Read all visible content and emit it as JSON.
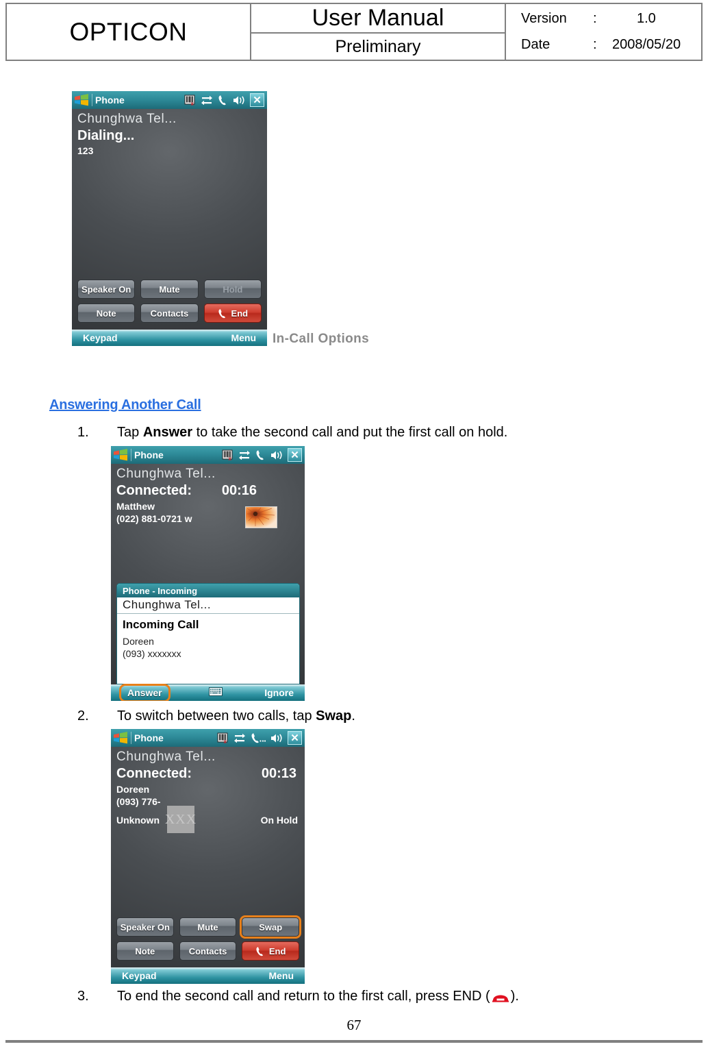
{
  "doc_header": {
    "logo": "OPTICON",
    "title": "User Manual",
    "subtitle": "Preliminary",
    "version_label": "Version",
    "version_colon": ":",
    "version_value": "1.0",
    "date_label": "Date",
    "date_colon": ":",
    "date_value": "2008/05/20"
  },
  "page_number": "67",
  "captions": {
    "in_call_options": "In-Call Options"
  },
  "section": {
    "heading": "Answering Another Call"
  },
  "steps": [
    {
      "num": "1.",
      "pre": "Tap ",
      "bold": "Answer",
      "post": " to take the second call and put the first call on hold."
    },
    {
      "num": "2.",
      "pre": "To switch between two calls, tap ",
      "bold": "Swap",
      "post": "."
    },
    {
      "num": "3.",
      "pre": "To end the second call and return to the first call, press END (",
      "bold": "",
      "post": ")."
    }
  ],
  "screens": {
    "dialing": {
      "title": "Phone",
      "tray_icons": [
        "barcode-disabled-icon",
        "connectivity-icon",
        "phone-icon",
        "volume-icon"
      ],
      "close_label": "✕",
      "operator": "Chunghwa Tel...",
      "status": "Dialing...",
      "number": "123",
      "buttons_row1": [
        {
          "label": "Speaker On",
          "state": "normal"
        },
        {
          "label": "Mute",
          "state": "normal"
        },
        {
          "label": "Hold",
          "state": "disabled"
        }
      ],
      "buttons_row2": [
        {
          "label": "Note",
          "state": "normal"
        },
        {
          "label": "Contacts",
          "state": "normal"
        },
        {
          "label": "End",
          "state": "end"
        }
      ],
      "soft_left": "Keypad",
      "soft_right": "Menu"
    },
    "incoming": {
      "title": "Phone",
      "close_label": "✕",
      "operator": "Chunghwa Tel...",
      "status_label": "Connected:",
      "timer": "00:16",
      "contact_name": "Matthew",
      "contact_number": "(022) 881-0721 w",
      "popup_title": "Phone - Incoming",
      "popup_operator": "Chunghwa Tel...",
      "popup_heading": "Incoming Call",
      "popup_caller": "Doreen",
      "popup_number": "(093) xxxxxxx",
      "soft_left": "Answer",
      "soft_mid": "keyboard-icon",
      "soft_right": "Ignore"
    },
    "swap": {
      "title": "Phone",
      "close_label": "✕",
      "operator": "Chunghwa Tel...",
      "status_label": "Connected:",
      "timer": "00:13",
      "contact_name": "Doreen",
      "contact_number": "(093) 776-",
      "redaction_text": "XXX",
      "second_caller": "Unknown",
      "second_state": "On Hold",
      "buttons_row1": [
        {
          "label": "Speaker On",
          "state": "normal"
        },
        {
          "label": "Mute",
          "state": "normal"
        },
        {
          "label": "Swap",
          "state": "highlight"
        }
      ],
      "buttons_row2": [
        {
          "label": "Note",
          "state": "normal"
        },
        {
          "label": "Contacts",
          "state": "normal"
        },
        {
          "label": "End",
          "state": "end"
        }
      ],
      "soft_left": "Keypad",
      "soft_right": "Menu"
    }
  },
  "colors": {
    "heading_blue": "#2a6fe0",
    "highlight_orange": "#e8801a",
    "end_red": "#cf3e2f",
    "titlebar_teal": "#2e8b99",
    "caption_gray": "#8a8a8a"
  }
}
